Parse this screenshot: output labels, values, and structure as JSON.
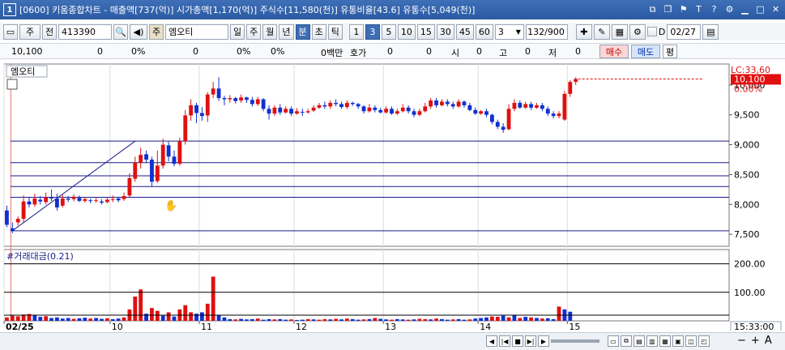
{
  "window": {
    "number": "1",
    "title": "[0600] 키움종합차트 - 매출액[737(억)] 시가총액[1,170(억)] 주식수[11,580(천)] 유통비율[43.6] 유통수[5,049(천)]",
    "icons": [
      "restore-icon",
      "copy-icon",
      "pin-icon",
      "font-icon",
      "help-icon",
      "settings-icon",
      "minimize-icon",
      "maximize-icon",
      "close-icon"
    ]
  },
  "toolbar": {
    "mode": "주",
    "prev": "전",
    "code": "413390",
    "search": "🔍",
    "sound": "◀",
    "stock_tag": "주",
    "stock_name": "엠오티",
    "periods": [
      "일",
      "주",
      "월",
      "년",
      "분",
      "초",
      "틱"
    ],
    "selected_period": "분",
    "intervals": [
      "1",
      "3",
      "5",
      "10",
      "15",
      "30",
      "45",
      "60"
    ],
    "selected_interval": "3",
    "interval_input": "3",
    "count": "132",
    "count_total": "/900",
    "d_label": "D",
    "date": "02/27"
  },
  "quote": {
    "price": "10,100",
    "v1": "0",
    "p1": "0%",
    "v2": "0",
    "p2": "0%",
    "p3": "0%",
    "amount": "0백만",
    "hoga": "호가",
    "hoga_v1": "0",
    "hoga_v2": "0",
    "open_label": "시",
    "open": "0",
    "high_label": "고",
    "high": "0",
    "low_label": "저",
    "low": "0",
    "buy": "매수",
    "sell": "매도",
    "avg": "평"
  },
  "chart_panel": {
    "stock_label": "엠오티",
    "lc_label": "LC:33,60",
    "hc_label": "HC:0,00",
    "last_price_tag": "10,100",
    "last_pct_tag": "0.00%",
    "volume_title": "#거래대금(0.21)",
    "status_time": "15:33:00"
  },
  "chart_data": {
    "type": "candlestick",
    "price_axis": {
      "ticks": [
        "10,000",
        "9,500",
        "9,000",
        "8,500",
        "8,000",
        "7,500"
      ],
      "tick_values": [
        10000,
        9500,
        9000,
        8500,
        8000,
        7500
      ],
      "range": [
        7300,
        10350
      ]
    },
    "volume_axis": {
      "ticks": [
        "200.00",
        "100.00"
      ],
      "tick_values": [
        200,
        100
      ],
      "range": [
        0,
        250
      ]
    },
    "x_ticks": [
      {
        "label": "02/25",
        "index": 0
      },
      {
        "label": "10",
        "index": 19
      },
      {
        "label": "11",
        "index": 35
      },
      {
        "label": "12",
        "index": 52
      },
      {
        "label": "13",
        "index": 68
      },
      {
        "label": "14",
        "index": 85
      },
      {
        "label": "15",
        "index": 101
      }
    ],
    "horizontal_levels": [
      9060,
      8700,
      8480,
      8300,
      8120,
      7560
    ],
    "trendline": [
      {
        "index": 1,
        "value": 7560
      },
      {
        "index": 23,
        "value": 9060
      }
    ],
    "candles": [
      [
        7900,
        7660,
        7980,
        7620
      ],
      [
        7600,
        7560,
        7700,
        7520
      ],
      [
        7700,
        7760,
        7800,
        7650
      ],
      [
        7760,
        8050,
        8150,
        7700
      ],
      [
        8050,
        8000,
        8120,
        7950
      ],
      [
        8000,
        8100,
        8180,
        7960
      ],
      [
        8080,
        8050,
        8140,
        8000
      ],
      [
        8040,
        8120,
        8200,
        8000
      ],
      [
        8120,
        8100,
        8250,
        8060
      ],
      [
        8100,
        7950,
        8180,
        7900
      ],
      [
        7980,
        8100,
        8160,
        7950
      ],
      [
        8100,
        8080,
        8140,
        8040
      ],
      [
        8090,
        8130,
        8170,
        8050
      ],
      [
        8110,
        8060,
        8150,
        8040
      ],
      [
        8060,
        8090,
        8120,
        8030
      ],
      [
        8070,
        8060,
        8100,
        8020
      ],
      [
        8060,
        8070,
        8110,
        8030
      ],
      [
        8050,
        8030,
        8090,
        8000
      ],
      [
        8040,
        8080,
        8120,
        8020
      ],
      [
        8080,
        8090,
        8150,
        8040
      ],
      [
        8100,
        8070,
        8130,
        8040
      ],
      [
        8090,
        8140,
        8200,
        8060
      ],
      [
        8150,
        8440,
        8520,
        8120
      ],
      [
        8430,
        8700,
        8800,
        8380
      ],
      [
        8700,
        8830,
        8950,
        8600
      ],
      [
        8840,
        8750,
        8900,
        8700
      ],
      [
        8750,
        8380,
        8800,
        8300
      ],
      [
        8390,
        8650,
        8900,
        8360
      ],
      [
        8650,
        9000,
        9100,
        8600
      ],
      [
        8990,
        8800,
        9050,
        8720
      ],
      [
        8800,
        8680,
        8900,
        8640
      ],
      [
        8680,
        9060,
        9120,
        8650
      ],
      [
        9060,
        9490,
        9580,
        9000
      ],
      [
        9490,
        9660,
        9760,
        9400
      ],
      [
        9660,
        9530,
        9700,
        9360
      ],
      [
        9530,
        9480,
        9630,
        9400
      ],
      [
        9490,
        9840,
        9880,
        9380
      ],
      [
        9840,
        9940,
        10050,
        9780
      ],
      [
        9940,
        9780,
        10130,
        9730
      ],
      [
        9780,
        9760,
        9820,
        9660
      ],
      [
        9760,
        9780,
        9830,
        9700
      ],
      [
        9780,
        9730,
        9800,
        9690
      ],
      [
        9740,
        9790,
        9840,
        9700
      ],
      [
        9790,
        9750,
        9800,
        9700
      ],
      [
        9750,
        9680,
        9800,
        9640
      ],
      [
        9680,
        9760,
        9800,
        9650
      ],
      [
        9760,
        9600,
        9780,
        9560
      ],
      [
        9600,
        9520,
        9660,
        9420
      ],
      [
        9520,
        9620,
        9660,
        9480
      ],
      [
        9620,
        9540,
        9680,
        9500
      ],
      [
        9540,
        9600,
        9640,
        9520
      ],
      [
        9600,
        9520,
        9640,
        9480
      ],
      [
        9520,
        9560,
        9610,
        9500
      ],
      [
        9550,
        9540,
        9600,
        9480
      ],
      [
        9540,
        9560,
        9600,
        9520
      ],
      [
        9570,
        9620,
        9660,
        9550
      ],
      [
        9620,
        9660,
        9700,
        9600
      ],
      [
        9660,
        9640,
        9720,
        9600
      ],
      [
        9640,
        9700,
        9740,
        9600
      ],
      [
        9700,
        9680,
        9760,
        9640
      ],
      [
        9680,
        9630,
        9720,
        9600
      ],
      [
        9630,
        9700,
        9740,
        9600
      ],
      [
        9700,
        9680,
        9720,
        9650
      ],
      [
        9680,
        9640,
        9700,
        9600
      ],
      [
        9640,
        9560,
        9660,
        9520
      ],
      [
        9560,
        9620,
        9680,
        9540
      ],
      [
        9620,
        9580,
        9660,
        9540
      ],
      [
        9580,
        9540,
        9620,
        9520
      ],
      [
        9540,
        9600,
        9640,
        9520
      ],
      [
        9600,
        9520,
        9640,
        9500
      ],
      [
        9520,
        9560,
        9600,
        9500
      ],
      [
        9560,
        9620,
        9680,
        9540
      ],
      [
        9620,
        9560,
        9660,
        9520
      ],
      [
        9560,
        9500,
        9600,
        9460
      ],
      [
        9500,
        9560,
        9600,
        9480
      ],
      [
        9560,
        9640,
        9700,
        9540
      ],
      [
        9640,
        9740,
        9780,
        9600
      ],
      [
        9740,
        9660,
        9780,
        9620
      ],
      [
        9660,
        9720,
        9760,
        9640
      ],
      [
        9720,
        9680,
        9760,
        9640
      ],
      [
        9680,
        9640,
        9720,
        9600
      ],
      [
        9640,
        9720,
        9760,
        9620
      ],
      [
        9720,
        9660,
        9740,
        9620
      ],
      [
        9660,
        9580,
        9700,
        9560
      ],
      [
        9580,
        9520,
        9620,
        9500
      ],
      [
        9520,
        9560,
        9580,
        9500
      ],
      [
        9560,
        9500,
        9600,
        9460
      ],
      [
        9500,
        9380,
        9520,
        9340
      ],
      [
        9380,
        9300,
        9420,
        9260
      ],
      [
        9300,
        9250,
        9360,
        9200
      ],
      [
        9260,
        9600,
        9680,
        9240
      ],
      [
        9600,
        9700,
        9760,
        9560
      ],
      [
        9700,
        9620,
        9740,
        9600
      ],
      [
        9620,
        9680,
        9720,
        9600
      ],
      [
        9680,
        9620,
        9720,
        9580
      ],
      [
        9620,
        9660,
        9700,
        9600
      ],
      [
        9660,
        9600,
        9700,
        9560
      ],
      [
        9600,
        9520,
        9640,
        9480
      ],
      [
        9520,
        9480,
        9560,
        9440
      ],
      [
        9480,
        9520,
        9560,
        9440
      ],
      [
        9420,
        9850,
        9900,
        9400
      ],
      [
        9850,
        10050,
        10080,
        9800
      ],
      [
        10050,
        10100,
        10130,
        10000
      ]
    ],
    "volume": [
      [
        12,
        1
      ],
      [
        18,
        1
      ],
      [
        16,
        1
      ],
      [
        22,
        1
      ],
      [
        24,
        1
      ],
      [
        20,
        0
      ],
      [
        14,
        0
      ],
      [
        16,
        1
      ],
      [
        10,
        0
      ],
      [
        12,
        0
      ],
      [
        8,
        0
      ],
      [
        10,
        0
      ],
      [
        7,
        1
      ],
      [
        9,
        0
      ],
      [
        11,
        0
      ],
      [
        8,
        1
      ],
      [
        10,
        0
      ],
      [
        7,
        0
      ],
      [
        9,
        1
      ],
      [
        6,
        0
      ],
      [
        8,
        0
      ],
      [
        12,
        1
      ],
      [
        40,
        1
      ],
      [
        85,
        1
      ],
      [
        110,
        1
      ],
      [
        25,
        0
      ],
      [
        45,
        1
      ],
      [
        35,
        1
      ],
      [
        18,
        0
      ],
      [
        30,
        1
      ],
      [
        15,
        0
      ],
      [
        40,
        1
      ],
      [
        55,
        1
      ],
      [
        30,
        1
      ],
      [
        25,
        0
      ],
      [
        30,
        0
      ],
      [
        60,
        1
      ],
      [
        155,
        1
      ],
      [
        20,
        0
      ],
      [
        12,
        0
      ],
      [
        6,
        0
      ],
      [
        5,
        1
      ],
      [
        7,
        0
      ],
      [
        5,
        0
      ],
      [
        6,
        0
      ],
      [
        8,
        1
      ],
      [
        4,
        0
      ],
      [
        6,
        0
      ],
      [
        5,
        1
      ],
      [
        6,
        0
      ],
      [
        4,
        0
      ],
      [
        5,
        1
      ],
      [
        3,
        0
      ],
      [
        4,
        0
      ],
      [
        6,
        1
      ],
      [
        5,
        0
      ],
      [
        4,
        1
      ],
      [
        6,
        1
      ],
      [
        5,
        0
      ],
      [
        7,
        1
      ],
      [
        5,
        0
      ],
      [
        8,
        1
      ],
      [
        6,
        0
      ],
      [
        4,
        0
      ],
      [
        5,
        1
      ],
      [
        6,
        0
      ],
      [
        10,
        1
      ],
      [
        7,
        0
      ],
      [
        5,
        0
      ],
      [
        4,
        1
      ],
      [
        6,
        0
      ],
      [
        5,
        0
      ],
      [
        4,
        1
      ],
      [
        5,
        0
      ],
      [
        7,
        1
      ],
      [
        6,
        1
      ],
      [
        5,
        0
      ],
      [
        8,
        1
      ],
      [
        6,
        0
      ],
      [
        4,
        0
      ],
      [
        5,
        1
      ],
      [
        6,
        0
      ],
      [
        4,
        0
      ],
      [
        5,
        1
      ],
      [
        8,
        0
      ],
      [
        10,
        0
      ],
      [
        12,
        0
      ],
      [
        15,
        1
      ],
      [
        14,
        1
      ],
      [
        18,
        0
      ],
      [
        12,
        1
      ],
      [
        20,
        0
      ],
      [
        10,
        1
      ],
      [
        14,
        0
      ],
      [
        12,
        1
      ],
      [
        10,
        0
      ],
      [
        8,
        1
      ],
      [
        9,
        0
      ],
      [
        6,
        0
      ],
      [
        50,
        1
      ],
      [
        40,
        0
      ],
      [
        32,
        0
      ]
    ]
  },
  "status_buttons": [
    "◀",
    "|◀",
    "■",
    "▶|",
    "▶"
  ],
  "status_right_buttons": [
    "−",
    "+",
    "A"
  ]
}
